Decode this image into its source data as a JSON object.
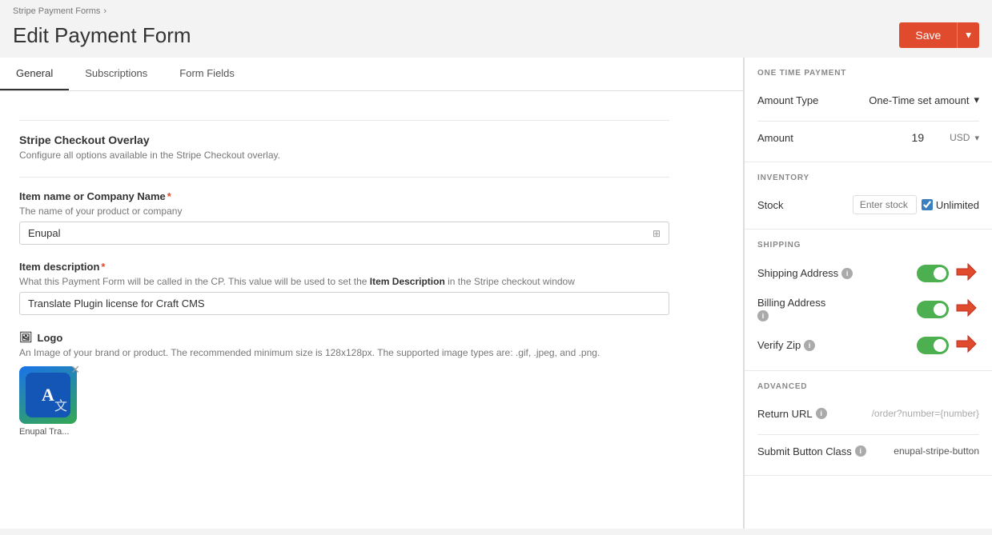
{
  "breadcrumb": {
    "parent": "Stripe Payment Forms",
    "separator": "›"
  },
  "header": {
    "title": "Edit Payment Form",
    "save_label": "Save"
  },
  "tabs": [
    {
      "id": "general",
      "label": "General",
      "active": true
    },
    {
      "id": "subscriptions",
      "label": "Subscriptions",
      "active": false
    },
    {
      "id": "form-fields",
      "label": "Form Fields",
      "active": false
    }
  ],
  "sections": {
    "stripe_checkout": {
      "title": "Stripe Checkout Overlay",
      "description": "Configure all options available in the Stripe Checkout overlay."
    },
    "item_name": {
      "label": "Item name or Company Name",
      "required": true,
      "hint": "The name of your product or company",
      "value": "Enupal"
    },
    "item_description": {
      "label": "Item description",
      "required": true,
      "hint_before": "What this Payment Form will be called in the CP. This value will be used to set the ",
      "hint_strong": "Item Description",
      "hint_after": " in the Stripe checkout window",
      "value": "Translate Plugin license for Craft CMS"
    },
    "logo": {
      "label": "Logo",
      "description": "An Image of your brand or product. The recommended minimum size is 128x128px. The supported image types are: .gif, .jpeg, and .png.",
      "file_name": "Enupal Tra...",
      "has_image": true
    }
  },
  "sidebar": {
    "one_time_payment": {
      "title": "ONE TIME PAYMENT",
      "amount_type_label": "Amount Type",
      "amount_type_value": "One-Time set amount",
      "amount_label": "Amount",
      "amount_value": "19",
      "currency": "USD"
    },
    "inventory": {
      "title": "INVENTORY",
      "stock_label": "Stock",
      "stock_placeholder": "Enter stock",
      "unlimited_label": "Unlimited",
      "unlimited_checked": true
    },
    "shipping": {
      "title": "SHIPPING",
      "shipping_address_label": "Shipping Address",
      "shipping_address_enabled": true,
      "billing_address_label": "Billing Address",
      "billing_address_enabled": true,
      "verify_zip_label": "Verify Zip",
      "verify_zip_enabled": true
    },
    "advanced": {
      "title": "ADVANCED",
      "return_url_label": "Return URL",
      "return_url_value": "/order?number={number}",
      "submit_button_class_label": "Submit Button Class",
      "submit_button_class_value": "enupal-stripe-button"
    }
  }
}
